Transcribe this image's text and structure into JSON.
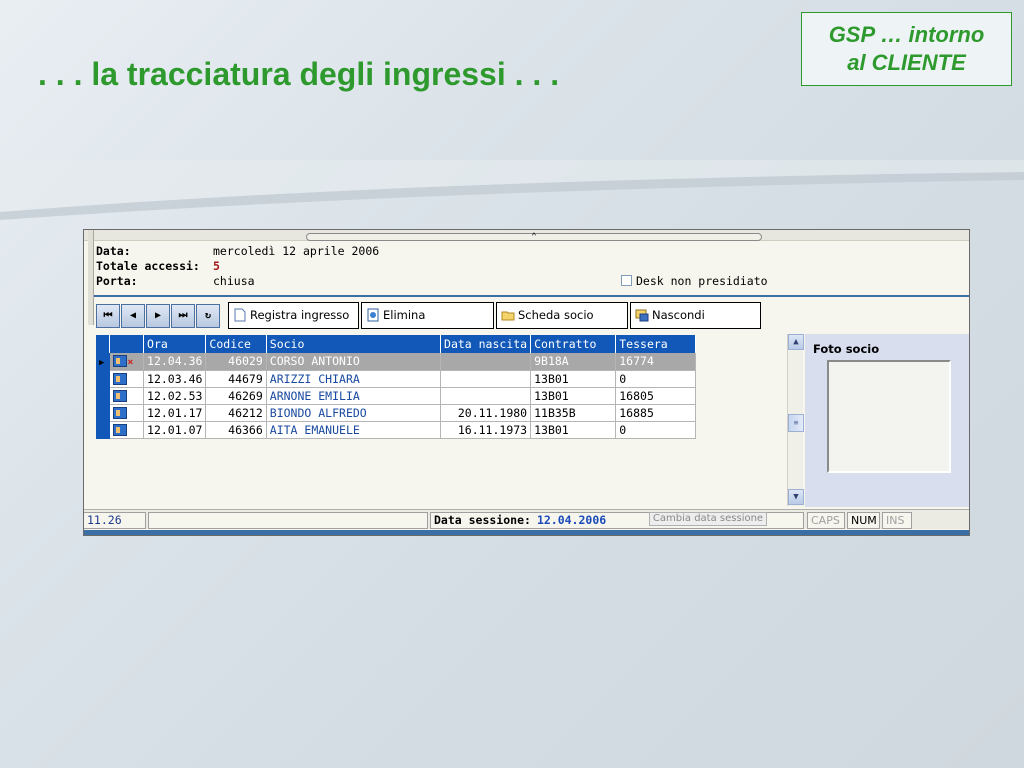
{
  "slide": {
    "title": ". . . la tracciatura degli ingressi . . .",
    "brand_line1": "GSP … intorno",
    "brand_line2": "al CLIENTE"
  },
  "info": {
    "data_label": "Data:",
    "data_value": "mercoledì 12 aprile 2006",
    "totale_label": "Totale accessi:",
    "totale_value": "5",
    "porta_label": "Porta:",
    "porta_value": "chiusa",
    "desk_label": "Desk non presidiato"
  },
  "toolbar": {
    "registra": "Registra ingresso",
    "elimina": "Elimina",
    "scheda": "Scheda socio",
    "nascondi": "Nascondi"
  },
  "grid": {
    "headers": [
      "Ora",
      "Codice",
      "Socio",
      "Data nascita",
      "Contratto",
      "Tessera"
    ],
    "rows": [
      [
        "12.04.36",
        "46029",
        "CORSO ANTONIO",
        "",
        "9B18A",
        "16774"
      ],
      [
        "12.03.46",
        "44679",
        "ARIZZI CHIARA",
        "",
        "13B01",
        "0"
      ],
      [
        "12.02.53",
        "46269",
        "ARNONE EMILIA",
        "",
        "13B01",
        "16805"
      ],
      [
        "12.01.17",
        "46212",
        "BIONDO ALFREDO",
        "20.11.1980",
        "11B35B",
        "16885"
      ],
      [
        "12.01.07",
        "46366",
        "AITA EMANUELE",
        "16.11.1973",
        "13B01",
        "0"
      ]
    ]
  },
  "photo": {
    "label": "Foto socio"
  },
  "status": {
    "time": "11.26",
    "sessione_label": "Data sessione:",
    "sessione_value": "12.04.2006",
    "cambia": "Cambia data sessione",
    "caps": "CAPS",
    "num": "NUM",
    "ins": "INS"
  }
}
